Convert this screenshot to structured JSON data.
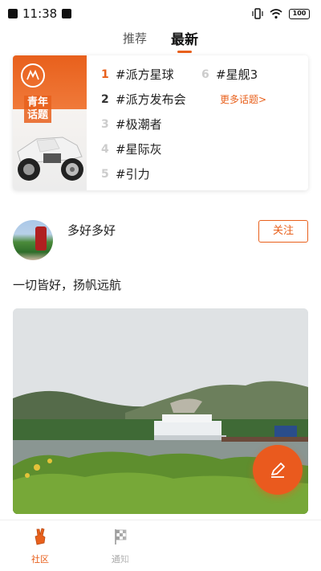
{
  "status_bar": {
    "time": "11:38",
    "battery": "100"
  },
  "top_tabs": [
    {
      "label": "推荐",
      "active": false
    },
    {
      "label": "最新",
      "active": true
    }
  ],
  "topics": {
    "banner_text_line1": "青年",
    "banner_text_line2": "话题",
    "items": [
      {
        "rank": "1",
        "label": "#派方星球"
      },
      {
        "rank": "2",
        "label": "#派方发布会"
      },
      {
        "rank": "3",
        "label": "#极潮者"
      },
      {
        "rank": "4",
        "label": "#星际灰"
      },
      {
        "rank": "5",
        "label": "#引力"
      },
      {
        "rank": "6",
        "label": "#星舰3"
      }
    ],
    "more_label": "更多话题>"
  },
  "post": {
    "username": "多好多好",
    "follow_label": "关注",
    "text": "一切皆好，扬帆远航"
  },
  "colors": {
    "accent": "#e8601c"
  },
  "bottom_nav": [
    {
      "label": "社区",
      "icon": "hand-peace-icon",
      "active": true
    },
    {
      "label": "通知",
      "icon": "checkered-flag-icon",
      "active": false
    }
  ]
}
